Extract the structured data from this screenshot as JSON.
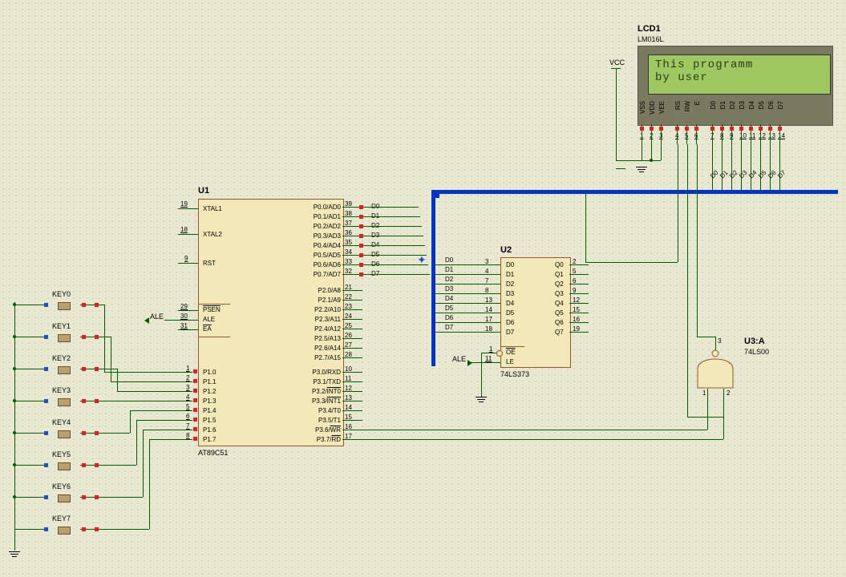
{
  "u1": {
    "ref": "U1",
    "part": "AT89C51",
    "left_pins": [
      {
        "name": "XTAL1",
        "num": "19"
      },
      {
        "name": "XTAL2",
        "num": "18"
      },
      {
        "name": "RST",
        "num": "9"
      },
      {
        "name": "PSEN",
        "num": "29",
        "over": true
      },
      {
        "name": "ALE",
        "num": "30"
      },
      {
        "name": "EA",
        "num": "31",
        "over": true
      },
      {
        "name": "P1.0",
        "num": "1"
      },
      {
        "name": "P1.1",
        "num": "2"
      },
      {
        "name": "P1.2",
        "num": "3"
      },
      {
        "name": "P1.3",
        "num": "4"
      },
      {
        "name": "P1.4",
        "num": "5"
      },
      {
        "name": "P1.5",
        "num": "6"
      },
      {
        "name": "P1.6",
        "num": "7"
      },
      {
        "name": "P1.7",
        "num": "8"
      }
    ],
    "right_top": [
      {
        "name": "P0.0/AD0",
        "num": "39"
      },
      {
        "name": "P0.1/AD1",
        "num": "38"
      },
      {
        "name": "P0.2/AD2",
        "num": "37"
      },
      {
        "name": "P0.3/AD3",
        "num": "36"
      },
      {
        "name": "P0.4/AD4",
        "num": "35"
      },
      {
        "name": "P0.5/AD5",
        "num": "34"
      },
      {
        "name": "P0.6/AD6",
        "num": "33"
      },
      {
        "name": "P0.7/AD7",
        "num": "32"
      }
    ],
    "right_p2": [
      {
        "name": "P2.0/A8",
        "num": "21"
      },
      {
        "name": "P2.1/A9",
        "num": "22"
      },
      {
        "name": "P2.2/A10",
        "num": "23"
      },
      {
        "name": "P2.3/A11",
        "num": "24"
      },
      {
        "name": "P2.4/A12",
        "num": "25"
      },
      {
        "name": "P2.5/A13",
        "num": "26"
      },
      {
        "name": "P2.6/A14",
        "num": "27"
      },
      {
        "name": "P2.7/A15",
        "num": "28"
      }
    ],
    "right_p3": [
      {
        "name": "P3.0/RXD",
        "num": "10"
      },
      {
        "name": "P3.1/TXD",
        "num": "11"
      },
      {
        "name": "P3.2/INT0",
        "num": "12",
        "over": "INT0"
      },
      {
        "name": "P3.3/INT1",
        "num": "13",
        "over": "INT1"
      },
      {
        "name": "P3.4/T0",
        "num": "14"
      },
      {
        "name": "P3.5/T1",
        "num": "15"
      },
      {
        "name": "P3.6/WR",
        "num": "16",
        "over": "WR"
      },
      {
        "name": "P3.7/RD",
        "num": "17",
        "over": "RD"
      }
    ]
  },
  "u2": {
    "ref": "U2",
    "part": "74LS373",
    "left": [
      {
        "name": "D0",
        "num": "3"
      },
      {
        "name": "D1",
        "num": "4"
      },
      {
        "name": "D2",
        "num": "7"
      },
      {
        "name": "D3",
        "num": "8"
      },
      {
        "name": "D4",
        "num": "13"
      },
      {
        "name": "D5",
        "num": "14"
      },
      {
        "name": "D6",
        "num": "17"
      },
      {
        "name": "D7",
        "num": "18"
      }
    ],
    "right": [
      {
        "name": "Q0",
        "num": "2"
      },
      {
        "name": "Q1",
        "num": "5"
      },
      {
        "name": "Q2",
        "num": "6"
      },
      {
        "name": "Q3",
        "num": "9"
      },
      {
        "name": "Q4",
        "num": "12"
      },
      {
        "name": "Q5",
        "num": "15"
      },
      {
        "name": "Q6",
        "num": "16"
      },
      {
        "name": "Q7",
        "num": "19"
      }
    ],
    "ctrl": [
      {
        "name": "OE",
        "num": "1",
        "over": true
      },
      {
        "name": "LE",
        "num": "11"
      }
    ]
  },
  "u3": {
    "ref": "U3:A",
    "part": "74LS00",
    "in": [
      "1",
      "2"
    ],
    "out": "3"
  },
  "lcd": {
    "ref": "LCD1",
    "part": "LM016L",
    "line1": "This programm",
    "line2": " by user",
    "pins_top": [
      "VSS",
      "VDD",
      "VEE",
      "RS",
      "RW",
      "E",
      "D0",
      "D1",
      "D2",
      "D3",
      "D4",
      "D5",
      "D6",
      "D7"
    ],
    "pins_num": [
      "1",
      "2",
      "3",
      "4",
      "5",
      "6",
      "7",
      "8",
      "9",
      "10",
      "11",
      "12",
      "13",
      "14"
    ]
  },
  "keys": [
    "KEY0",
    "KEY1",
    "KEY2",
    "KEY3",
    "KEY4",
    "KEY5",
    "KEY6",
    "KEY7"
  ],
  "nets": {
    "vcc": "VCC",
    "ale": "ALE",
    "d": [
      "D0",
      "D1",
      "D2",
      "D3",
      "D4",
      "D5",
      "D6",
      "D7"
    ]
  }
}
